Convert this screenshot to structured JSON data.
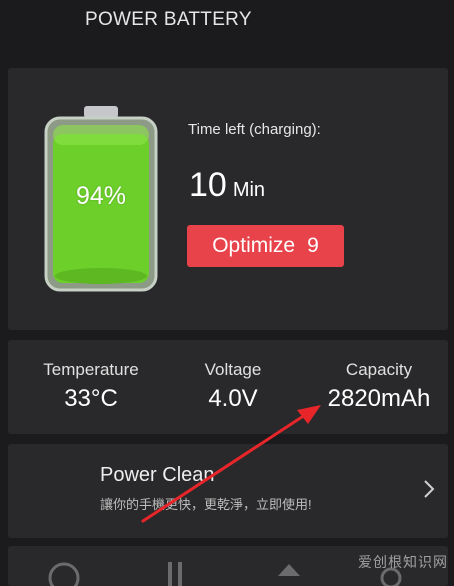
{
  "header": {
    "title": "POWER BATTERY"
  },
  "battery": {
    "percent_text": "94%",
    "level": 0.94,
    "time_label": "Time left (charging):",
    "time_value": "10",
    "time_unit": "Min",
    "optimize_label": "Optimize",
    "optimize_count": "9"
  },
  "stats": [
    {
      "label": "Temperature",
      "value": "33°C"
    },
    {
      "label": "Voltage",
      "value": "4.0V"
    },
    {
      "label": "Capacity",
      "value": "2820mAh"
    }
  ],
  "clean": {
    "title": "Power Clean",
    "subtitle": "讓你的手機更快，更乾淨，立即使用!"
  },
  "watermark": "爱创根知识网",
  "colors": {
    "background": "#1b1b1d",
    "card": "#29292b",
    "battery_green": "#6ccf2a",
    "button_red": "#e8434a",
    "annotation_arrow": "#e8262a"
  },
  "icons": [
    "battery-icon",
    "chevron-right-icon",
    "annotation-arrow"
  ]
}
